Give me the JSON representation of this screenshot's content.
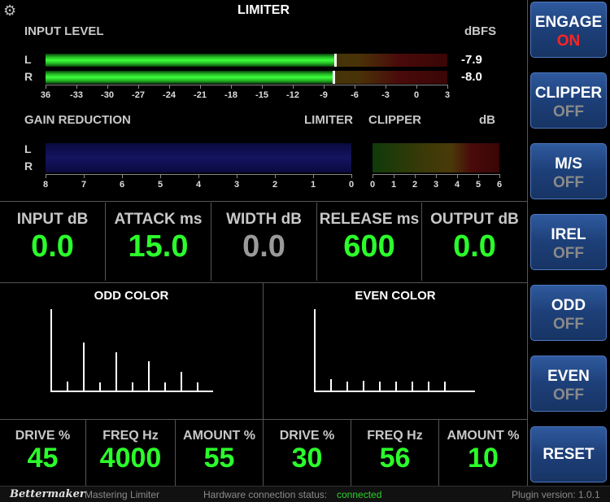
{
  "meter": {
    "title": "LIMITER",
    "input_label": "INPUT LEVEL",
    "input_unit": "dBFS",
    "channel_l": "L",
    "channel_r": "R",
    "input_l_value": "-7.9",
    "input_r_value": "-8.0",
    "input_scale": [
      "36",
      "-33",
      "-30",
      "-27",
      "-24",
      "-21",
      "-18",
      "-15",
      "-12",
      "-9",
      "-6",
      "-3",
      "0",
      "3"
    ],
    "gr_label": "GAIN REDUCTION",
    "gr_limiter_label": "LIMITER",
    "gr_clipper_label": "CLIPPER",
    "gr_unit": "dB",
    "limiter_scale": [
      "8",
      "7",
      "6",
      "5",
      "4",
      "3",
      "2",
      "1",
      "0"
    ],
    "clipper_scale": [
      "0",
      "1",
      "2",
      "3",
      "4",
      "5",
      "6"
    ],
    "colors": {
      "meter_green": "#3cff3c",
      "gr_blue": "#141460"
    }
  },
  "params": [
    {
      "label": "INPUT dB",
      "value": "0.0",
      "active": true
    },
    {
      "label": "ATTACK ms",
      "value": "15.0",
      "active": true
    },
    {
      "label": "WIDTH dB",
      "value": "0.0",
      "active": false
    },
    {
      "label": "RELEASE ms",
      "value": "600",
      "active": true
    },
    {
      "label": "OUTPUT dB",
      "value": "0.0",
      "active": true
    }
  ],
  "odd": {
    "title": "ODD COLOR",
    "drive_label": "DRIVE %",
    "drive": "45",
    "freq_label": "FREQ Hz",
    "freq": "4000",
    "amount_label": "AMOUNT %",
    "amount": "55"
  },
  "even": {
    "title": "EVEN COLOR",
    "drive_label": "DRIVE %",
    "drive": "30",
    "freq_label": "FREQ Hz",
    "freq": "56",
    "amount_label": "AMOUNT %",
    "amount": "10"
  },
  "side_buttons": [
    {
      "label": "ENGAGE",
      "state": "ON"
    },
    {
      "label": "CLIPPER",
      "state": "OFF"
    },
    {
      "label": "M/S",
      "state": "OFF"
    },
    {
      "label": "IREL",
      "state": "OFF"
    },
    {
      "label": "ODD",
      "state": "OFF"
    },
    {
      "label": "EVEN",
      "state": "OFF"
    },
    {
      "label": "RESET",
      "state": ""
    }
  ],
  "footer": {
    "brand": "Bettermaker",
    "product": "Mastering Limiter",
    "hw_label": "Hardware connection status:",
    "hw_status": "connected",
    "version": "Plugin version: 1.0.1"
  },
  "icons": {
    "settings": "gear-icon"
  },
  "accent_colors": {
    "value_green": "#2bff2b",
    "engage_on": "#ff2323",
    "button_blue": "#1d3f78"
  }
}
